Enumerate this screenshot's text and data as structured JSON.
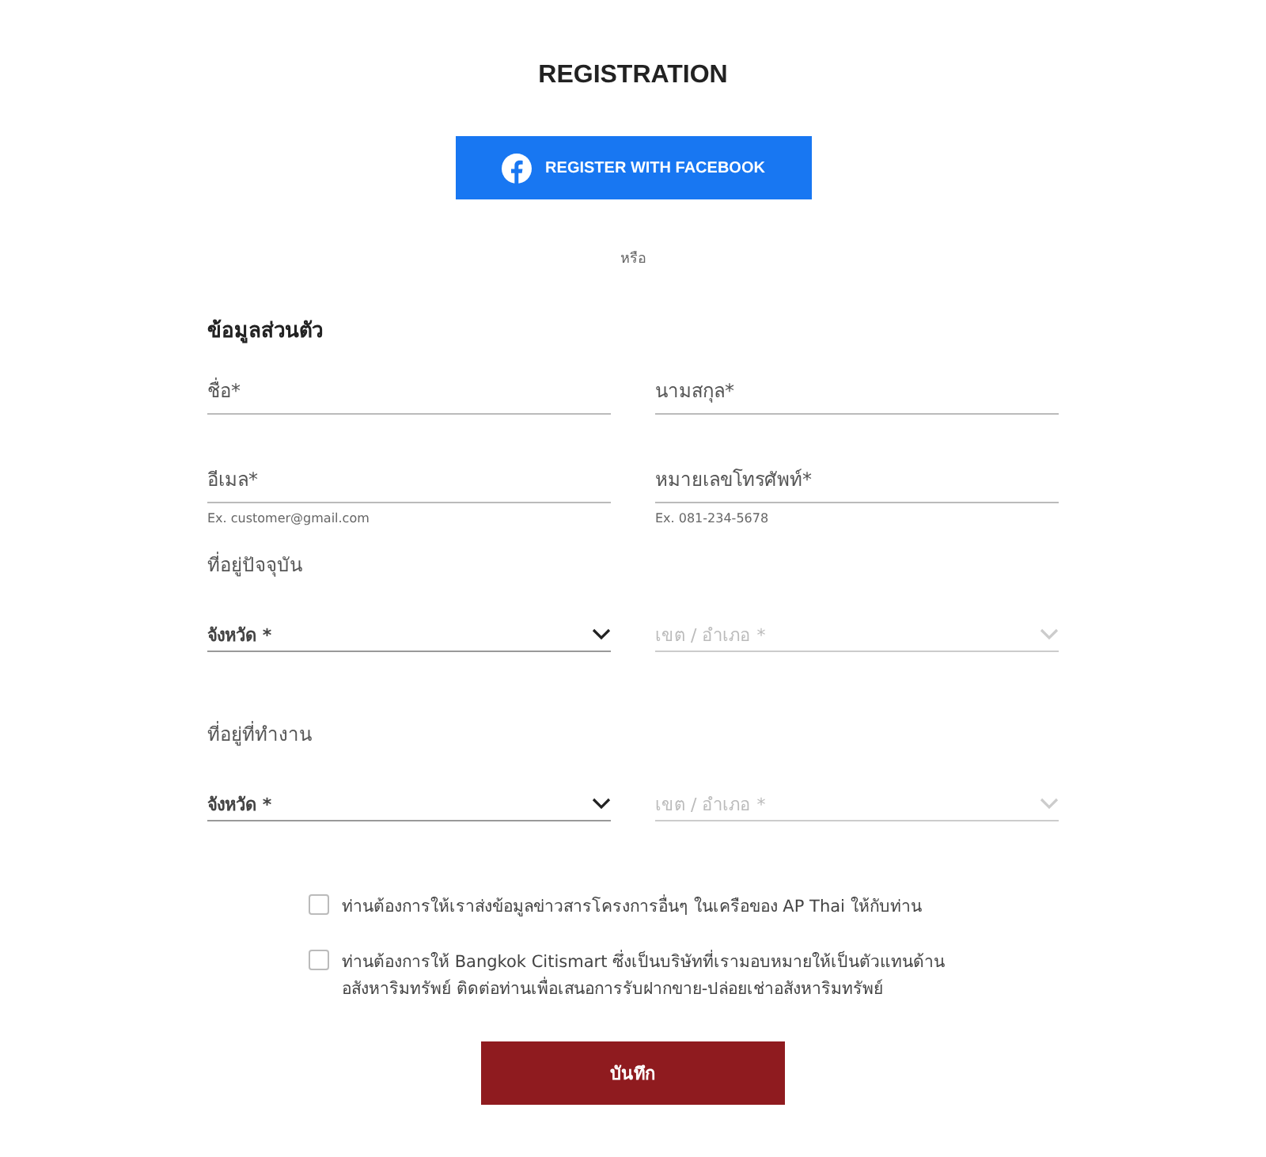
{
  "title": "REGISTRATION",
  "facebook_button": "REGISTER WITH FACEBOOK",
  "divider_text": "หรือ",
  "personal": {
    "heading": "ข้อมูลส่วนตัว",
    "fields": [
      {
        "placeholder": "ชื่อ*"
      },
      {
        "placeholder": "นามสกุล*"
      },
      {
        "placeholder": "อีเมล*",
        "hint": "Ex. customer@gmail.com"
      },
      {
        "placeholder": "หมายเลขโทรศัพท์*",
        "hint": "Ex. 081-234-5678"
      }
    ]
  },
  "addresses": [
    {
      "heading": "ที่อยู่ปัจจุบัน",
      "selects": [
        {
          "placeholder": "จังหวัด *",
          "disabled": false
        },
        {
          "placeholder": "เขต / อำเภอ *",
          "disabled": true
        }
      ]
    },
    {
      "heading": "ที่อยู่ที่ทำงาน",
      "selects": [
        {
          "placeholder": "จังหวัด *",
          "disabled": false
        },
        {
          "placeholder": "เขต / อำเภอ *",
          "disabled": true
        }
      ]
    }
  ],
  "consents": [
    {
      "label": "ท่านต้องการให้เราส่งข้อมูลข่าวสารโครงการอื่นๆ ในเครือของ AP Thai ให้กับท่าน",
      "checked": false
    },
    {
      "label": "ท่านต้องการให้ Bangkok Citismart ซึ่งเป็นบริษัทที่เรามอบหมายให้เป็นตัวแทนด้าน อสังหาริมทรัพย์ ติดต่อท่านเพื่อเสนอการรับฝากขาย-ปล่อยเช่าอสังหาริมทรัพย์",
      "checked": false
    }
  ],
  "submit_button": "บันทึก"
}
